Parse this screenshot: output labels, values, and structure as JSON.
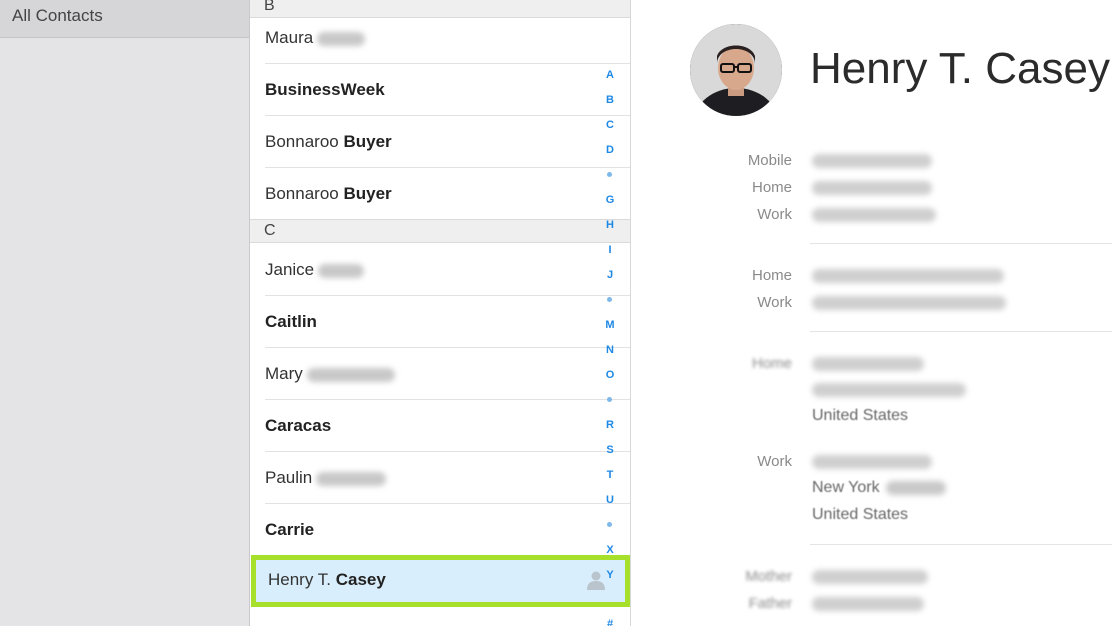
{
  "sidebar": {
    "items": [
      {
        "label": "All Contacts"
      }
    ]
  },
  "contacts": {
    "sections": [
      {
        "letter": "B"
      },
      {
        "letter": "C"
      }
    ],
    "rows": [
      {
        "first": "Maura",
        "last": ""
      },
      {
        "first": "",
        "last": "BusinessWeek"
      },
      {
        "first": "Bonnaroo",
        "last": "Buyer"
      },
      {
        "first": "Bonnaroo",
        "last": "Buyer"
      },
      {
        "first": "Janice",
        "last": ""
      },
      {
        "first": "",
        "last": "Caitlin"
      },
      {
        "first": "Mary",
        "last": ""
      },
      {
        "first": "",
        "last": "Caracas"
      },
      {
        "first": "Paulin",
        "last": ""
      },
      {
        "first": "",
        "last": "Carrie"
      },
      {
        "first": "Henry T.",
        "last": "Casey"
      }
    ],
    "selected_index": 10
  },
  "alphabet_index": [
    "A",
    "B",
    "C",
    "D",
    "•",
    "G",
    "H",
    "I",
    "J",
    "•",
    "M",
    "N",
    "O",
    "•",
    "R",
    "S",
    "T",
    "U",
    "•",
    "X",
    "Y",
    "#"
  ],
  "detail": {
    "name": "Henry T. Casey",
    "phone_labels": [
      "Mobile",
      "Home",
      "Work"
    ],
    "email_labels": [
      "Home",
      "Work"
    ],
    "address_home_label": "Home",
    "address_home_country": "United States",
    "address_work_label": "Work",
    "address_work_city": "New York",
    "address_work_country": "United States",
    "relation_labels": [
      "Mother",
      "Father"
    ]
  },
  "colors": {
    "accent": "#1e88e5",
    "highlight_outline": "#a6e02a",
    "selected_row": "#d9eefc"
  }
}
